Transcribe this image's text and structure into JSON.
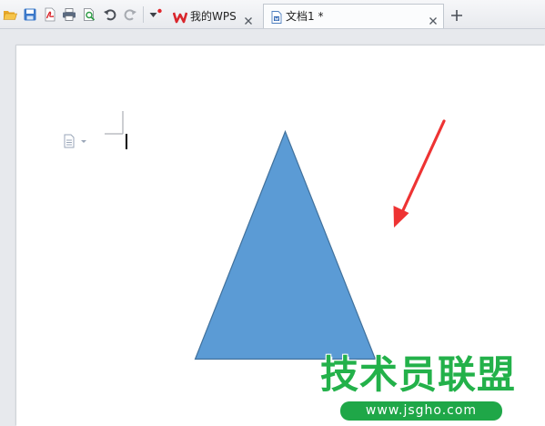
{
  "toolbar": {
    "icons": [
      "open-folder-icon",
      "save-icon",
      "export-pdf-icon",
      "print-icon",
      "print-preview-icon",
      "undo-icon",
      "redo-icon",
      "customize-toolbar-icon"
    ]
  },
  "tabs": [
    {
      "label": "我的WPS",
      "icon": "wps-logo-icon",
      "active": false
    },
    {
      "label": "文档1 *",
      "icon": "writer-document-icon",
      "active": true
    }
  ],
  "document": {
    "shape": {
      "type": "isosceles-triangle",
      "fill": "#5b9bd5",
      "stroke": "#41719c"
    },
    "annotation_arrow": {
      "color": "#ee3333"
    }
  },
  "watermark": {
    "title": "技术员联盟",
    "url": "www.jsgho.com",
    "color": "#23b14a"
  },
  "colors": {
    "accent": "#2b5797",
    "wps_red": "#d9262c"
  }
}
